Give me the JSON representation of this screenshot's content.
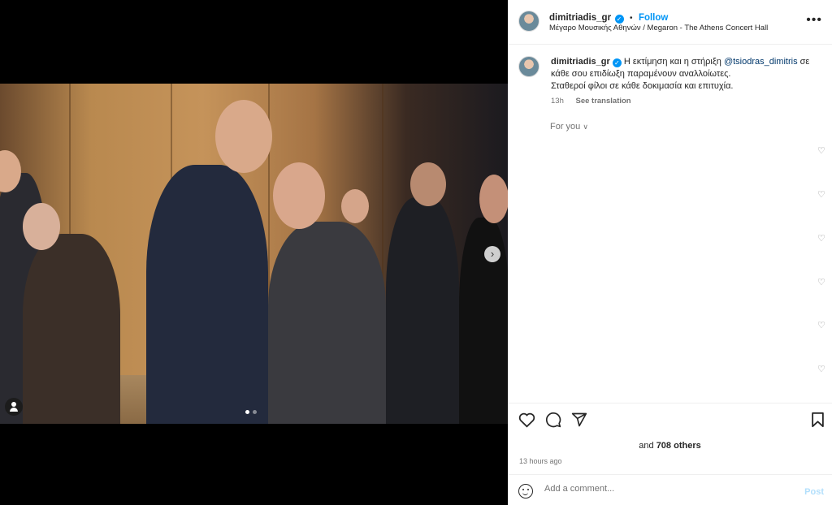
{
  "post": {
    "username": "dimitriadis_gr",
    "verified_mark": "✓",
    "follow_label": "Follow",
    "separator": "•",
    "location": "Μέγαρο Μουσικής Αθηνών / Megaron - The Athens Concert Hall",
    "more_icon": "more-horizontal-icon"
  },
  "caption": {
    "username": "dimitriadis_gr",
    "text_before": "Η εκτίμηση και η στήριξη ",
    "mention": "@tsiodras_dimitris",
    "text_after": " σε κάθε σου επιδίωξη παραμένουν αναλλοίωτες.",
    "line2": "Σταθεροί φίλοι σε κάθε δοκιμασία και επιτυχία.",
    "age": "13h",
    "see_translation": "See translation"
  },
  "for_you_label": "For you",
  "likes": {
    "prefix": "and ",
    "count": "708 others"
  },
  "timestamp": "13 hours ago",
  "comment": {
    "placeholder": "Add a comment...",
    "post_label": "Post"
  },
  "carousel": {
    "slides": 2,
    "active": 0
  },
  "colors": {
    "accent": "#0095f6",
    "post_disabled": "#b2dffc"
  }
}
